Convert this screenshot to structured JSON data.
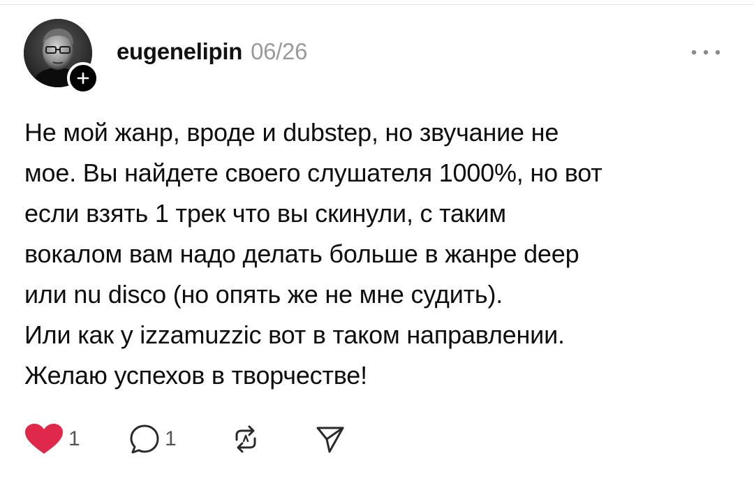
{
  "post": {
    "author": {
      "username": "eugenelipin",
      "avatar_icon": "user-avatar-photo",
      "follow_icon": "plus-icon"
    },
    "timestamp": "06/26",
    "more_icon": "more-horizontal-icon",
    "body_lines": [
      "Не мой жанр, вроде и dubstep, но звучание не",
      "мое. Вы найдете своего слушателя 1000%, но вот",
      "если взять 1 трек что вы скинули, с таким",
      "вокалом вам надо делать больше в жанре deep",
      "или nu disco (но опять же не мне судить).",
      "Или как у izzamuzzic  вот в таком направлении.",
      "Желаю успехов в творчестве!"
    ],
    "actions": {
      "like": {
        "icon": "heart-icon",
        "count": "1",
        "liked": true,
        "color": "#e0294a"
      },
      "reply": {
        "icon": "comment-bubble-icon",
        "count": "1"
      },
      "repost": {
        "icon": "repost-icon"
      },
      "share": {
        "icon": "send-icon"
      }
    }
  }
}
